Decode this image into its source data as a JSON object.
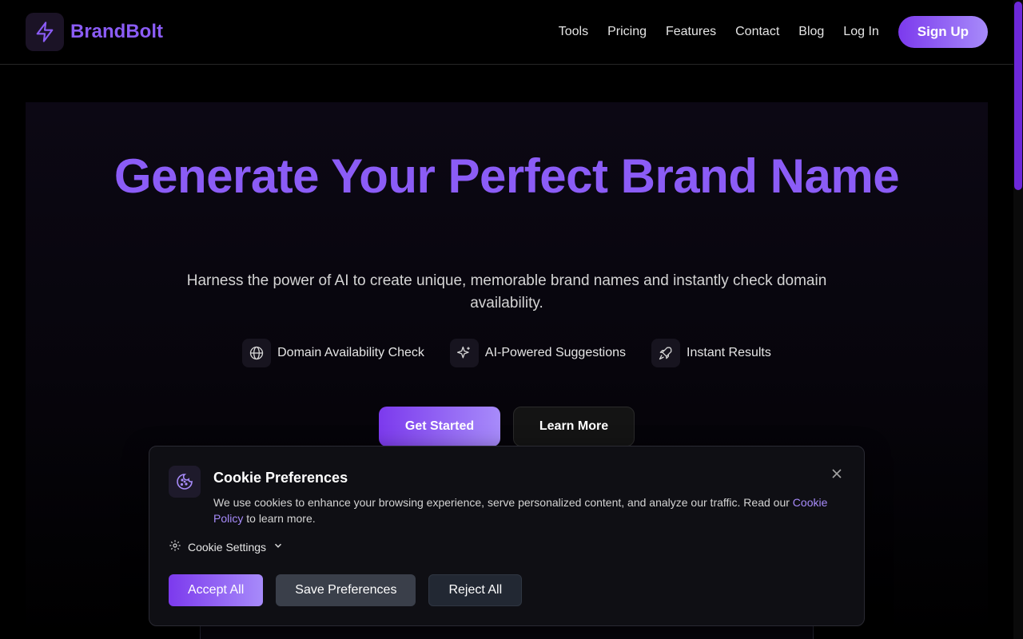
{
  "header": {
    "brand_name": "BrandBolt",
    "logo_icon": "bolt-icon",
    "nav": [
      "Tools",
      "Pricing",
      "Features",
      "Contact",
      "Blog",
      "Log In"
    ],
    "signup_label": "Sign Up"
  },
  "hero": {
    "title": "Generate Your Perfect Brand Name",
    "subtitle": "Harness the power of AI to create unique, memorable brand names and instantly check domain availability.",
    "features": [
      {
        "icon": "globe-icon",
        "label": "Domain Availability Check"
      },
      {
        "icon": "sparkles-icon",
        "label": "AI-Powered Suggestions"
      },
      {
        "icon": "rocket-icon",
        "label": "Instant Results"
      }
    ],
    "primary_button": "Get Started",
    "secondary_button": "Learn More"
  },
  "cookie": {
    "icon": "cookie-icon",
    "title": "Cookie Preferences",
    "text_before_link": "We use cookies to enhance your browsing experience, serve personalized content, and analyze our traffic. Read our",
    "link_text": "Cookie Policy",
    "text_after_link": "to learn more.",
    "settings_label": "Cookie Settings",
    "accept_label": "Accept All",
    "save_label": "Save Preferences",
    "reject_label": "Reject All"
  },
  "colors": {
    "accent": "#8b5cf6",
    "accent_light": "#a78bfa",
    "background": "#000000"
  }
}
